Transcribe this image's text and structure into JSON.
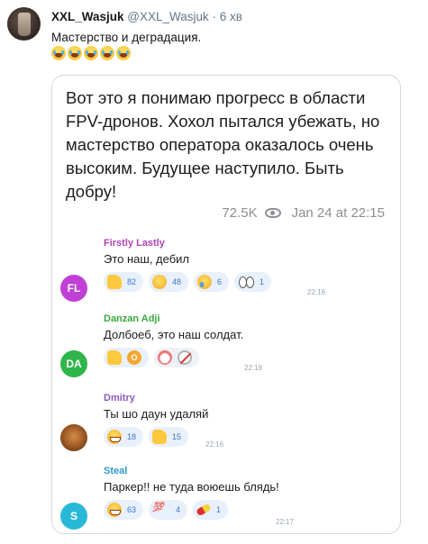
{
  "tweet": {
    "author_name": "XXL_Wasjuk",
    "handle_time": "@XXL_Wasjuk · 6 хв",
    "text": "Мастерство и деградация.",
    "emojis": [
      "grinning-tears-emoji",
      "grinning-tears-emoji",
      "grinning-tears-emoji",
      "grinning-tears-emoji",
      "grinning-tears-emoji"
    ]
  },
  "embedded_post": {
    "text": "Вот это я понимаю прогресс в области FPV-дронов. Хохол пытался убежать, но мастерство оператора оказалось очень высоким. Будущее наступило. Быть добру!",
    "views": "72.5K",
    "date": "Jan 24 at 22:15"
  },
  "comments": [
    {
      "initials": "FL",
      "avatar_color": "#c03fd6",
      "author": "Firstly Lastly",
      "author_color": "#b044b3",
      "text": "Это наш, дебил",
      "reactions": [
        {
          "icon": "thumbs-up-icon",
          "count": "82"
        },
        {
          "icon": "rofl-icon",
          "count": "48"
        },
        {
          "icon": "crying-icon",
          "count": "6"
        },
        {
          "icon": "eyes-icon",
          "count": "1"
        }
      ],
      "time": "22:16"
    },
    {
      "initials": "DA",
      "avatar_color": "#2fb54a",
      "author": "Danzan Adji",
      "author_color": "#3aa83f",
      "text": "Долбоеб, это наш солдат.",
      "reactions": [
        {
          "icon": "thumbs-up-icon",
          "count": "",
          "extra": "O"
        },
        {
          "icon": "clown-icon",
          "count": "",
          "extra2": "no-bell-icon"
        }
      ],
      "time": "22:18"
    },
    {
      "initials": "",
      "avatar_color": "#8a4a1c",
      "author": "Dmitry",
      "author_color": "#8a5bbd",
      "text": "Ты шо даун удаляй",
      "reactions": [
        {
          "icon": "grinning-icon",
          "count": "18"
        },
        {
          "icon": "thumbs-up-icon",
          "count": "15"
        }
      ],
      "time": "22:16"
    },
    {
      "initials": "S",
      "avatar_color": "#29b9d8",
      "author": "Steal",
      "author_color": "#2c9ad1",
      "text": "Паркер!! не туда воюешь блядь!",
      "reactions": [
        {
          "icon": "grinning-icon",
          "count": "63"
        },
        {
          "icon": "hundred-icon",
          "count": "4"
        },
        {
          "icon": "pill-icon",
          "count": "1"
        }
      ],
      "time": "22:17"
    }
  ]
}
